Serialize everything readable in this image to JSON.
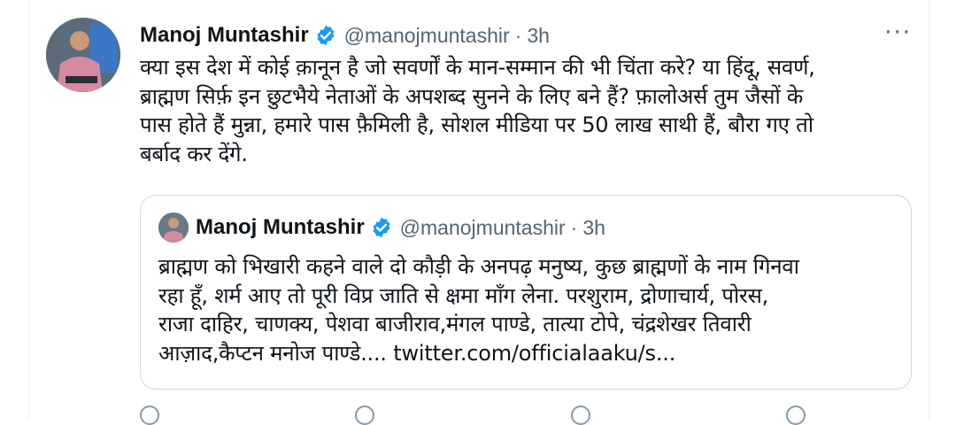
{
  "tweet": {
    "author_name": "Manoj Muntashir",
    "handle": "@manojmuntashir",
    "separator": "·",
    "time": "3h",
    "more_label": "···",
    "text": "क्या इस देश में कोई क़ानून है जो सवर्णों के मान-सम्मान की भी चिंता करे? या हिंदू, सवर्ण,\nब्राह्मण सिर्फ़ इन छुटभैये नेताओं के अपशब्द सुनने के लिए बने हैं? फ़ालोअर्स तुम जैसों के\nपास होते हैं मुन्ना, हमारे पास फ़ैमिली है, सोशल मीडिया पर 50 लाख साथी हैं, बौरा गए तो\nबर्बाद कर देंगे."
  },
  "quote": {
    "author_name": "Manoj Muntashir",
    "handle": "@manojmuntashir",
    "separator": "·",
    "time": "3h",
    "text": "ब्राह्मण को भिखारी कहने वाले दो कौड़ी के अनपढ़ मनुष्य, कुछ ब्राह्मणों के नाम गिनवा\nरहा हूँ, शर्म आए तो पूरी विप्र जाति से क्षमा माँग लेना. परशुराम, द्रोणाचार्य, पोरस,\nराजा दाहिर, चाणक्य, पेशवा बाजीराव,मंगल पाण्डे, तात्या टोपे, चंद्रशेखर तिवारी\nआज़ाद,कैप्टन मनोज पाण्डे.... twitter.com/officialaaku/s..."
  },
  "icons": {
    "verified": "verified-badge-icon",
    "more": "more-icon",
    "reply": "reply-icon",
    "retweet": "retweet-icon",
    "like": "like-icon",
    "share": "share-icon"
  },
  "colors": {
    "verified_blue": "#1d9bf0",
    "secondary_text": "#536471",
    "border": "#cfd9de"
  }
}
